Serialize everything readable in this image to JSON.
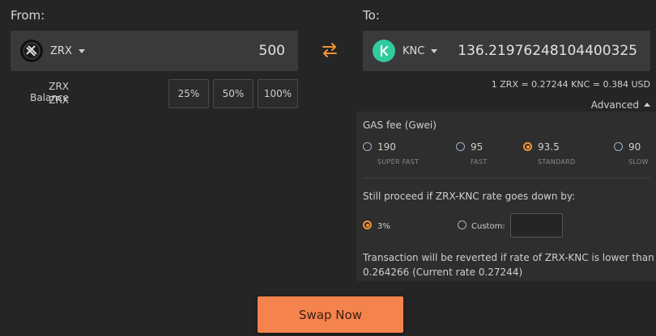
{
  "from": {
    "label": "From:",
    "token": "ZRX",
    "amount": "500",
    "balance_label": "ZRX Balance",
    "balance_unit": "ZRX",
    "percent_buttons": [
      "25%",
      "50%",
      "100%"
    ]
  },
  "to": {
    "label": "To:",
    "token": "KNC",
    "amount": "136.21976248104400325",
    "rate_text": "1 ZRX = 0.27244 KNC = 0.384 USD",
    "advanced_label": "Advanced"
  },
  "swap_icon": "swap-arrows-icon",
  "advanced": {
    "gas_title": "GAS fee (Gwei)",
    "gas_options": [
      {
        "value": "190",
        "label": "SUPER FAST",
        "selected": false
      },
      {
        "value": "95",
        "label": "FAST",
        "selected": false
      },
      {
        "value": "93.5",
        "label": "STANDARD",
        "selected": true
      },
      {
        "value": "90",
        "label": "SLOW",
        "selected": false
      }
    ],
    "slippage_title": "Still proceed if ZRX-KNC rate goes down by:",
    "slippage_option_3": "3%",
    "slippage_custom_label": "Custom:",
    "slippage_custom_value": "",
    "revert_note_line1": "Transaction will be reverted if rate of ZRX-KNC is lower than",
    "revert_note_line2": "0.264266 (Current rate 0.27244)"
  },
  "swap_button": "Swap Now",
  "colors": {
    "accent": "#f39237",
    "button": "#f5834d",
    "radio_off": "#9cb3cc",
    "knc_icon": "#31cb9e"
  }
}
